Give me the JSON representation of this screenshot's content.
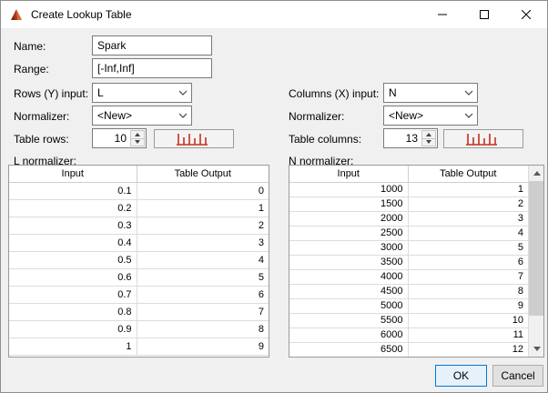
{
  "window": {
    "title": "Create Lookup Table"
  },
  "form": {
    "name_label": "Name:",
    "name_value": "Spark",
    "range_label": "Range:",
    "range_value": "[-Inf,Inf]",
    "rows_input_label": "Rows (Y) input:",
    "rows_input_value": "L",
    "cols_input_label": "Columns (X) input:",
    "cols_input_value": "N",
    "row_normalizer_label": "Normalizer:",
    "row_normalizer_value": "<New>",
    "col_normalizer_label": "Normalizer:",
    "col_normalizer_value": "<New>",
    "table_rows_label": "Table rows:",
    "table_rows_value": "10",
    "table_cols_label": "Table columns:",
    "table_cols_value": "13"
  },
  "left_table": {
    "caption": "L normalizer:",
    "headers": [
      "Input",
      "Table Output"
    ],
    "rows": [
      [
        "0.1",
        "0"
      ],
      [
        "0.2",
        "1"
      ],
      [
        "0.3",
        "2"
      ],
      [
        "0.4",
        "3"
      ],
      [
        "0.5",
        "4"
      ],
      [
        "0.6",
        "5"
      ],
      [
        "0.7",
        "6"
      ],
      [
        "0.8",
        "7"
      ],
      [
        "0.9",
        "8"
      ],
      [
        "1",
        "9"
      ]
    ]
  },
  "right_table": {
    "caption": "N normalizer:",
    "headers": [
      "Input",
      "Table Output"
    ],
    "rows": [
      [
        "1000",
        "1"
      ],
      [
        "1500",
        "2"
      ],
      [
        "2000",
        "3"
      ],
      [
        "2500",
        "4"
      ],
      [
        "3000",
        "5"
      ],
      [
        "3500",
        "6"
      ],
      [
        "4000",
        "7"
      ],
      [
        "4500",
        "8"
      ],
      [
        "5000",
        "9"
      ],
      [
        "5500",
        "10"
      ],
      [
        "6000",
        "11"
      ],
      [
        "6500",
        "12"
      ]
    ]
  },
  "buttons": {
    "ok": "OK",
    "cancel": "Cancel"
  },
  "colors": {
    "accent": "#0078d7",
    "breakpoint_icon": "#c62f1f",
    "titlebar": "#ffffff"
  },
  "icons": {
    "app_icon": "matlab-triangle",
    "breakpoints_icon": "red-comb-histogram",
    "dropdown_icon": "chevron-down",
    "spinner_icons": "up-down-arrows",
    "window_icons": "minimize-maximize-close"
  }
}
